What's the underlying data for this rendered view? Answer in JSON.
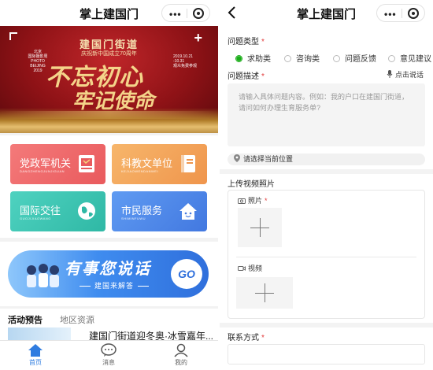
{
  "left_screen": {
    "nav_title": "掌上建国门",
    "capsule_dots": "•••",
    "banner": {
      "heading": "建国门街道",
      "subheading": "庆祝新中国成立70周年",
      "side_left": "北京\n国际摄影周\nPHOTO\nBEIJING\n2019",
      "side_right": "2019.10.21\n-10.31\n观众免费参观",
      "slogan_line1": "不忘初心",
      "slogan_line2": "牢记使命"
    },
    "tiles": [
      {
        "title": "党政军机关",
        "subtitle": "DANGZHENGJUNJIGUAN",
        "icon": "flag-book-icon",
        "color": "#e95a5d"
      },
      {
        "title": "科教文单位",
        "subtitle": "KEJIAOWENDANWEI",
        "icon": "book-icon",
        "color": "#ef954c"
      },
      {
        "title": "国际交往",
        "subtitle": "GUOJIJIAOWANG",
        "icon": "globe-icon",
        "color": "#2fb8a5"
      },
      {
        "title": "市民服务",
        "subtitle": "SHIMINFUWU",
        "icon": "house-icon",
        "color": "#4278e0"
      }
    ],
    "speak_banner": {
      "title": "有事您说话",
      "subtitle": "建国来解答",
      "go_label": "GO"
    },
    "activity": {
      "tab_active": "活动预告",
      "tab_other": "地区资源",
      "item_title": "建国门街道迎冬奥·冰雪嘉年..."
    },
    "tabbar": [
      {
        "label": "首页",
        "icon": "home-icon",
        "active": true
      },
      {
        "label": "消息",
        "icon": "message-icon",
        "active": false
      },
      {
        "label": "我的",
        "icon": "user-icon",
        "active": false
      }
    ]
  },
  "right_screen": {
    "nav_title": "掌上建国门",
    "capsule_dots": "•••",
    "form": {
      "type_label": "问题类型",
      "required_mark": "*",
      "type_options": [
        {
          "label": "求助类",
          "selected": true
        },
        {
          "label": "咨询类",
          "selected": false
        },
        {
          "label": "问题反馈",
          "selected": false
        },
        {
          "label": "意见建议",
          "selected": false
        }
      ],
      "desc_label": "问题描述",
      "voice_link": "点击说话",
      "desc_placeholder": "请输入具体问题内容。例如：我的户口在建国门街道，请问如何办理生育服务单?",
      "location_text": "请选择当前位置",
      "media_section": "上传视频照片",
      "photo_label": "照片",
      "video_label": "视频",
      "contact_label": "联系方式"
    }
  },
  "colors": {
    "accent_green": "#1aad19",
    "required_red": "#e23b3b",
    "active_tab_blue": "#2f7ce0"
  }
}
